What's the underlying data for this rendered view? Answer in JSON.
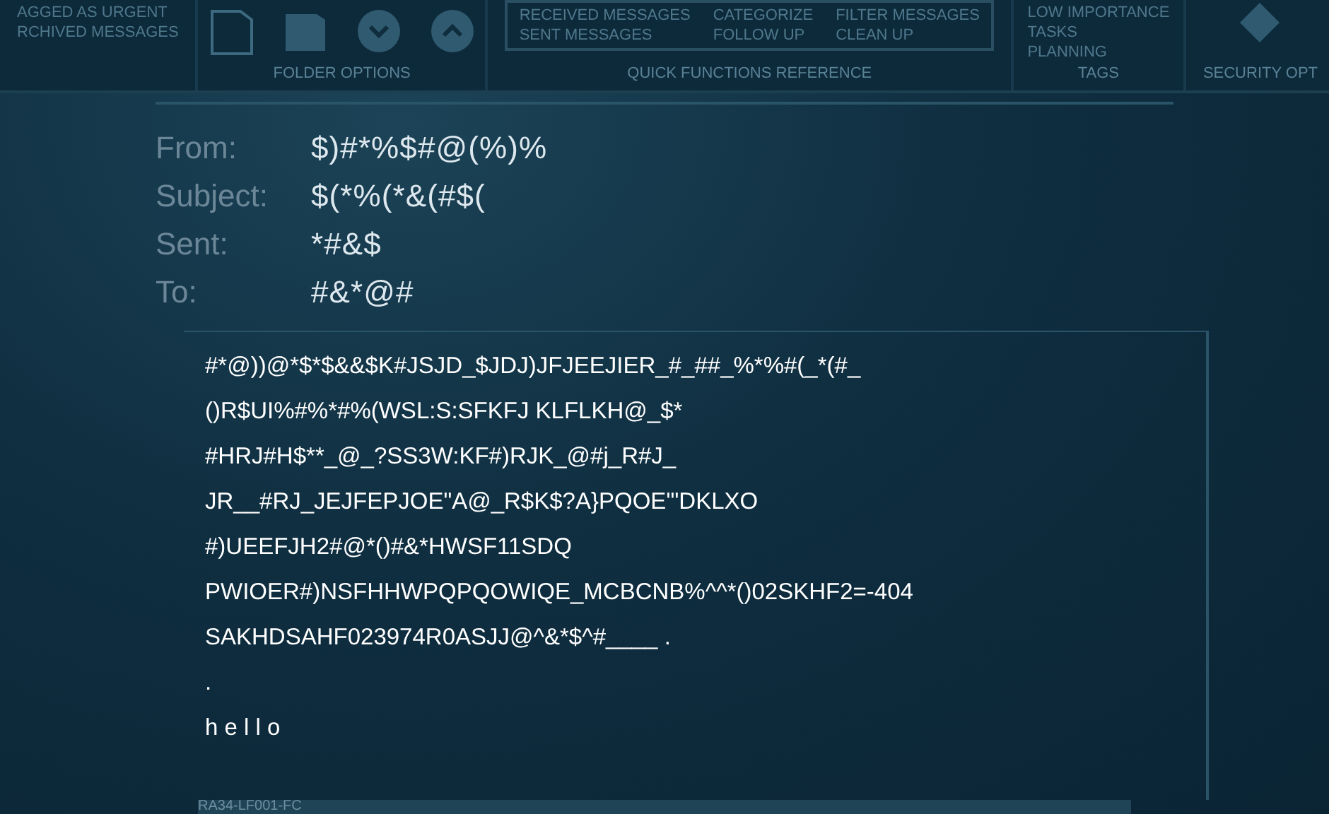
{
  "ribbon": {
    "groups": [
      {
        "kind": "list",
        "items": [
          "AGGED AS URGENT",
          "RCHIVED MESSAGES"
        ]
      },
      {
        "kind": "icons",
        "caption": "FOLDER OPTIONS"
      },
      {
        "kind": "table",
        "columns": [
          [
            "RECEIVED MESSAGES",
            "SENT MESSAGES"
          ],
          [
            "CATEGORIZE",
            "FOLLOW UP"
          ],
          [
            "FILTER MESSAGES",
            "CLEAN UP"
          ]
        ],
        "caption": "QUICK FUNCTIONS REFERENCE"
      },
      {
        "kind": "list",
        "items": [
          "LOW IMPORTANCE",
          "TASKS",
          "PLANNING"
        ],
        "caption": "TAGS"
      },
      {
        "kind": "security",
        "caption": "SECURITY OPT"
      }
    ]
  },
  "header": [
    {
      "label": "From:",
      "value": "$)#*%$#@(%)%"
    },
    {
      "label": "Subject:",
      "value": "$(*%(*&(#$("
    },
    {
      "label": "Sent:",
      "value": "*#&$"
    },
    {
      "label": "To:",
      "value": "#&*@#"
    }
  ],
  "body": {
    "lines": [
      "#*@))@*$*$&&$K#JSJD_$JDJ)JFJEEJIER_#_##_%*%#(_*(#_",
      "()R$UI%#%*#%(WSL:S:SFKFJ KLFLKH@_$*",
      "#HRJ#H$**_@_?SS3W:KF#)RJK_@#j_R#J_",
      "JR__#RJ_JEJFEPJOE\"A@_R$K$?A}PQOE'\"DKLXO",
      "#)UEEFJH2#@*()#&*HWSF11SDQ",
      "PWIOER#)NSFHHWPQPQOWIQE_MCBCNB%^^*()02SKHF2=-404",
      "SAKHDSAHF023974R0ASJJ@^&*$^#____ .",
      ".",
      "h e l l o"
    ]
  },
  "status_label": "RA34-LF001-FC"
}
